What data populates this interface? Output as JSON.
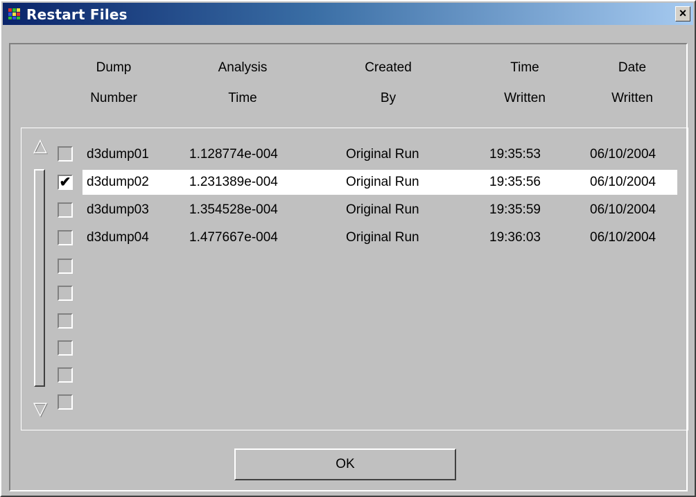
{
  "window": {
    "title": "Restart Files",
    "close_label": "×"
  },
  "columns": [
    {
      "line1": "Dump",
      "line2": "Number"
    },
    {
      "line1": "Analysis",
      "line2": "Time"
    },
    {
      "line1": "Created",
      "line2": "By"
    },
    {
      "line1": "Time",
      "line2": "Written"
    },
    {
      "line1": "Date",
      "line2": "Written"
    }
  ],
  "rows": [
    {
      "checked": false,
      "dump": "d3dump01",
      "analysis_time": "1.128774e-004",
      "created_by": "Original Run",
      "time_written": "19:35:53",
      "date_written": "06/10/2004"
    },
    {
      "checked": true,
      "dump": "d3dump02",
      "analysis_time": "1.231389e-004",
      "created_by": "Original Run",
      "time_written": "19:35:56",
      "date_written": "06/10/2004"
    },
    {
      "checked": false,
      "dump": "d3dump03",
      "analysis_time": "1.354528e-004",
      "created_by": "Original Run",
      "time_written": "19:35:59",
      "date_written": "06/10/2004"
    },
    {
      "checked": false,
      "dump": "d3dump04",
      "analysis_time": "1.477667e-004",
      "created_by": "Original Run",
      "time_written": "19:36:03",
      "date_written": "06/10/2004"
    }
  ],
  "checkmark": "✔",
  "scroll": {
    "up": "△",
    "down": "▽"
  },
  "ok_label": "OK",
  "colors": {
    "title_start": "#0a246a",
    "title_end": "#a6caf0",
    "face": "#c0c0c0",
    "selected_row": "#ffffff"
  }
}
